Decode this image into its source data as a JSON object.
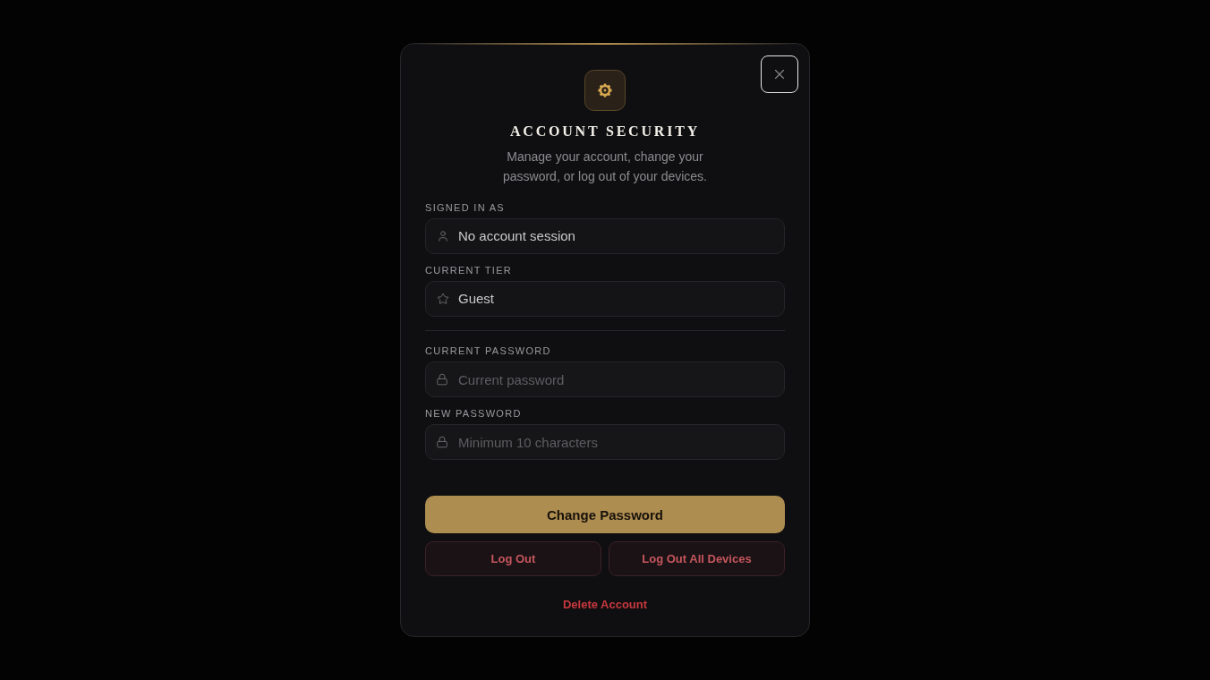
{
  "dialog": {
    "title": "ACCOUNT SECURITY",
    "subtitle": "Manage your account, change your password, or log out of your devices."
  },
  "signed_in_as": {
    "label": "SIGNED IN AS",
    "value": "No account session"
  },
  "current_tier": {
    "label": "CURRENT TIER",
    "value": "Guest"
  },
  "current_password": {
    "label": "CURRENT PASSWORD",
    "placeholder": "Current password"
  },
  "new_password": {
    "label": "NEW PASSWORD",
    "placeholder": "Minimum 10 characters"
  },
  "actions": {
    "change_password": "Change Password",
    "log_out": "Log Out",
    "log_out_all_devices": "Log Out All Devices",
    "delete_account": "Delete Account"
  }
}
